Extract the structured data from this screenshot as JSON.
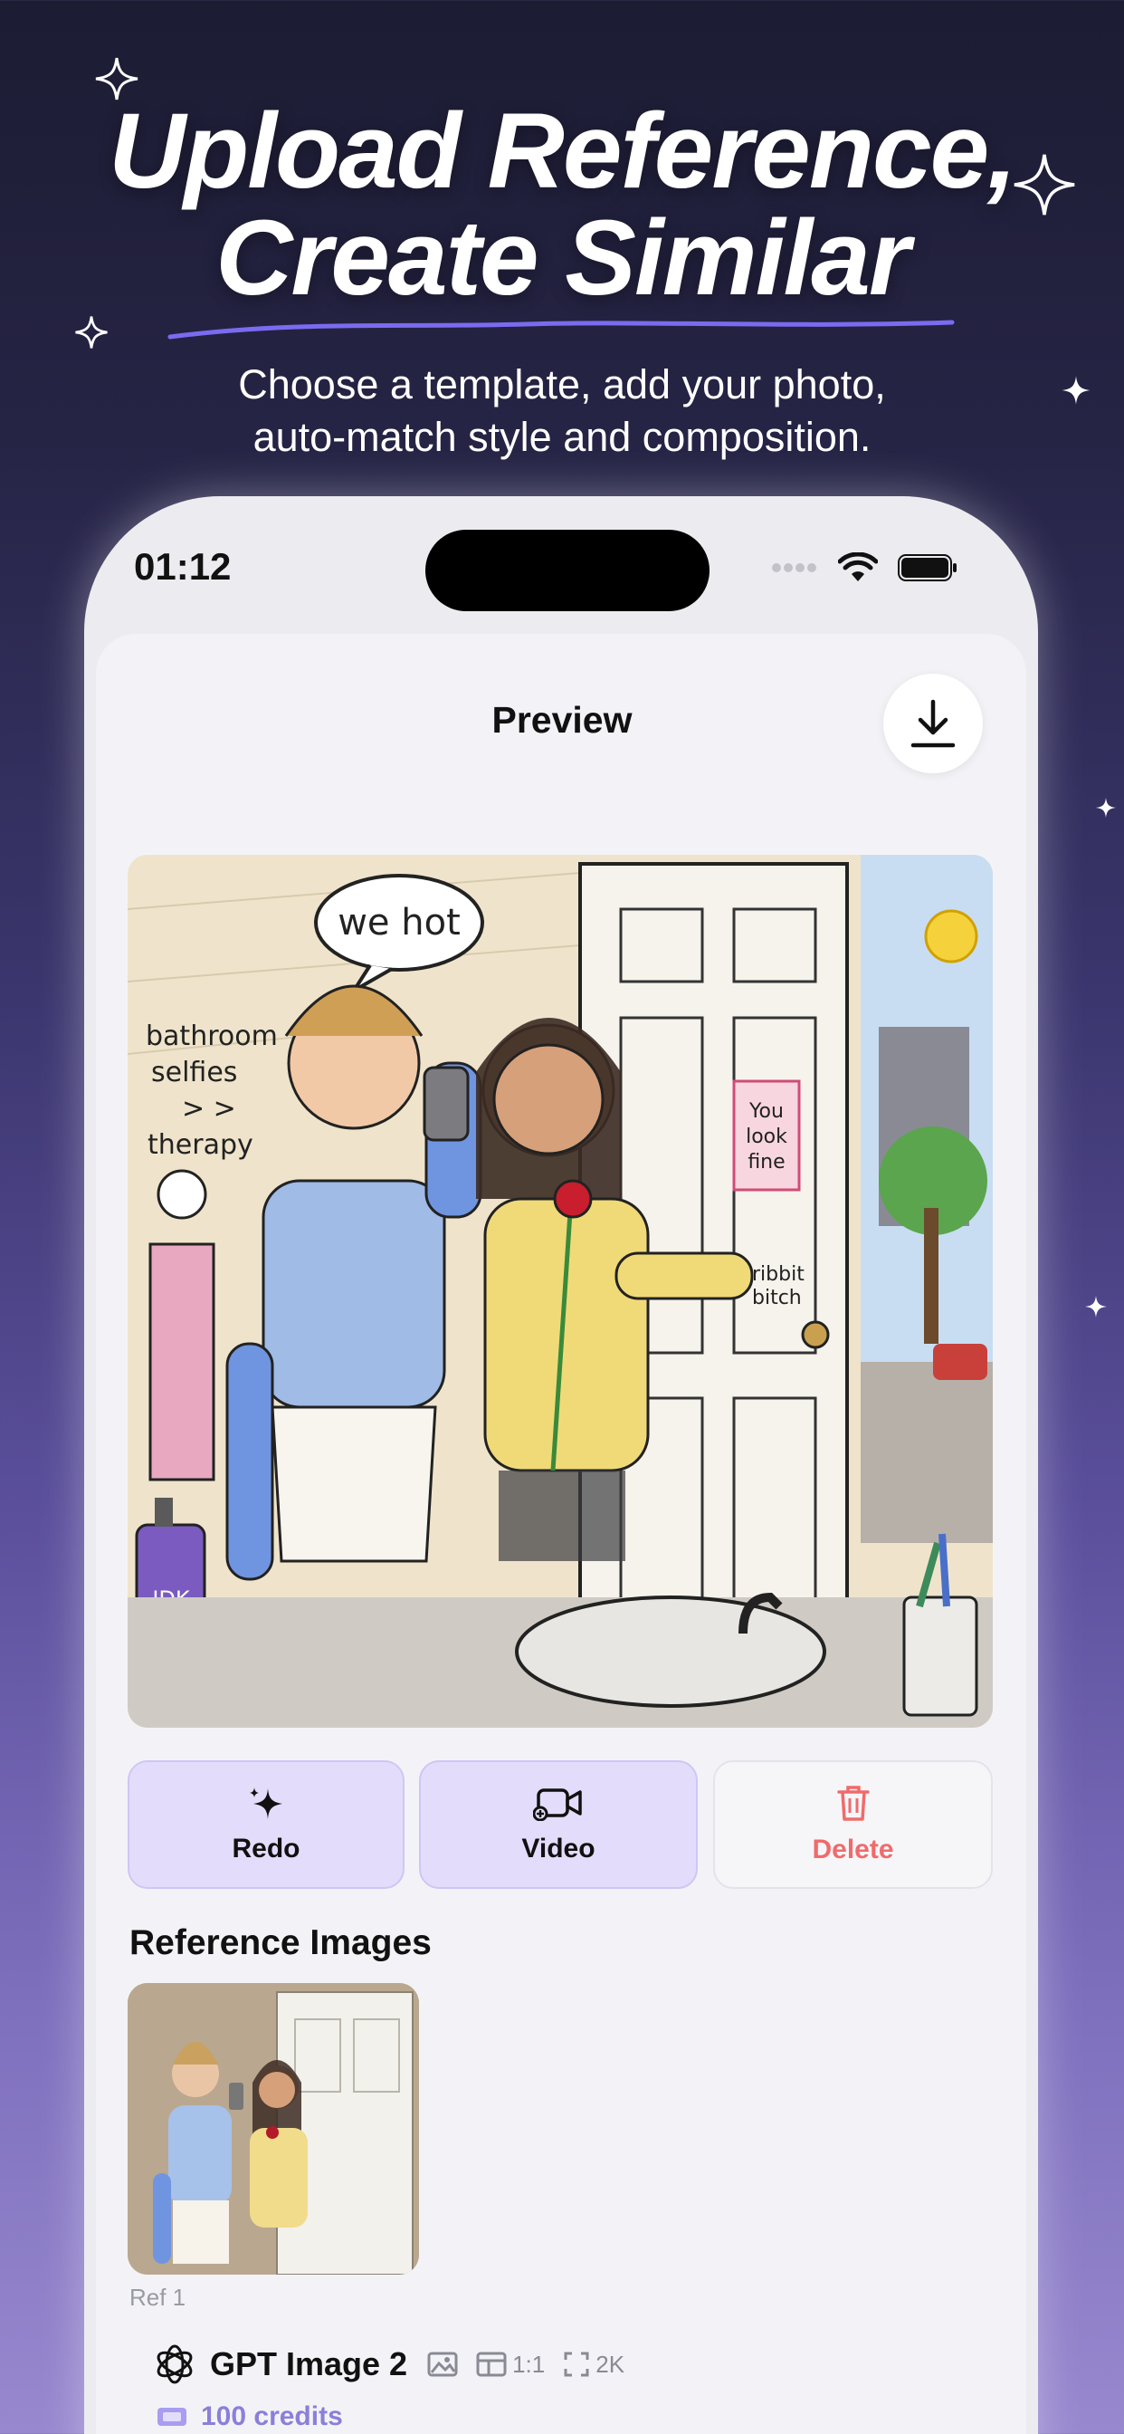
{
  "hero": {
    "title_line1": "Upload Reference,",
    "title_line2": "Create Similar",
    "subtitle_line1": "Choose a template, add your photo,",
    "subtitle_line2": "auto-match style and composition."
  },
  "status_bar": {
    "time": "01:12"
  },
  "header": {
    "title": "Preview",
    "download_icon": "download-icon"
  },
  "preview_image": {
    "speech_bubble": "we hot",
    "doodle_text": "bathroom selfies >> therapy",
    "bottle_text": "IDK LOL",
    "note_text": "You look fine",
    "frog_text": "ribbit bitch"
  },
  "actions": [
    {
      "label": "Redo",
      "icon": "sparkle-icon"
    },
    {
      "label": "Video",
      "icon": "video-camera-icon"
    },
    {
      "label": "Delete",
      "icon": "trash-icon"
    }
  ],
  "references": {
    "title": "Reference Images",
    "items": [
      {
        "label": "Ref 1"
      }
    ]
  },
  "model": {
    "name": "GPT Image 2",
    "ratio": "1:1",
    "resolution": "2K",
    "credits": "100 credits"
  },
  "colors": {
    "accent": "#8b7fd9",
    "delete": "#f06b6b",
    "action_bg": "#e3ddfb"
  }
}
